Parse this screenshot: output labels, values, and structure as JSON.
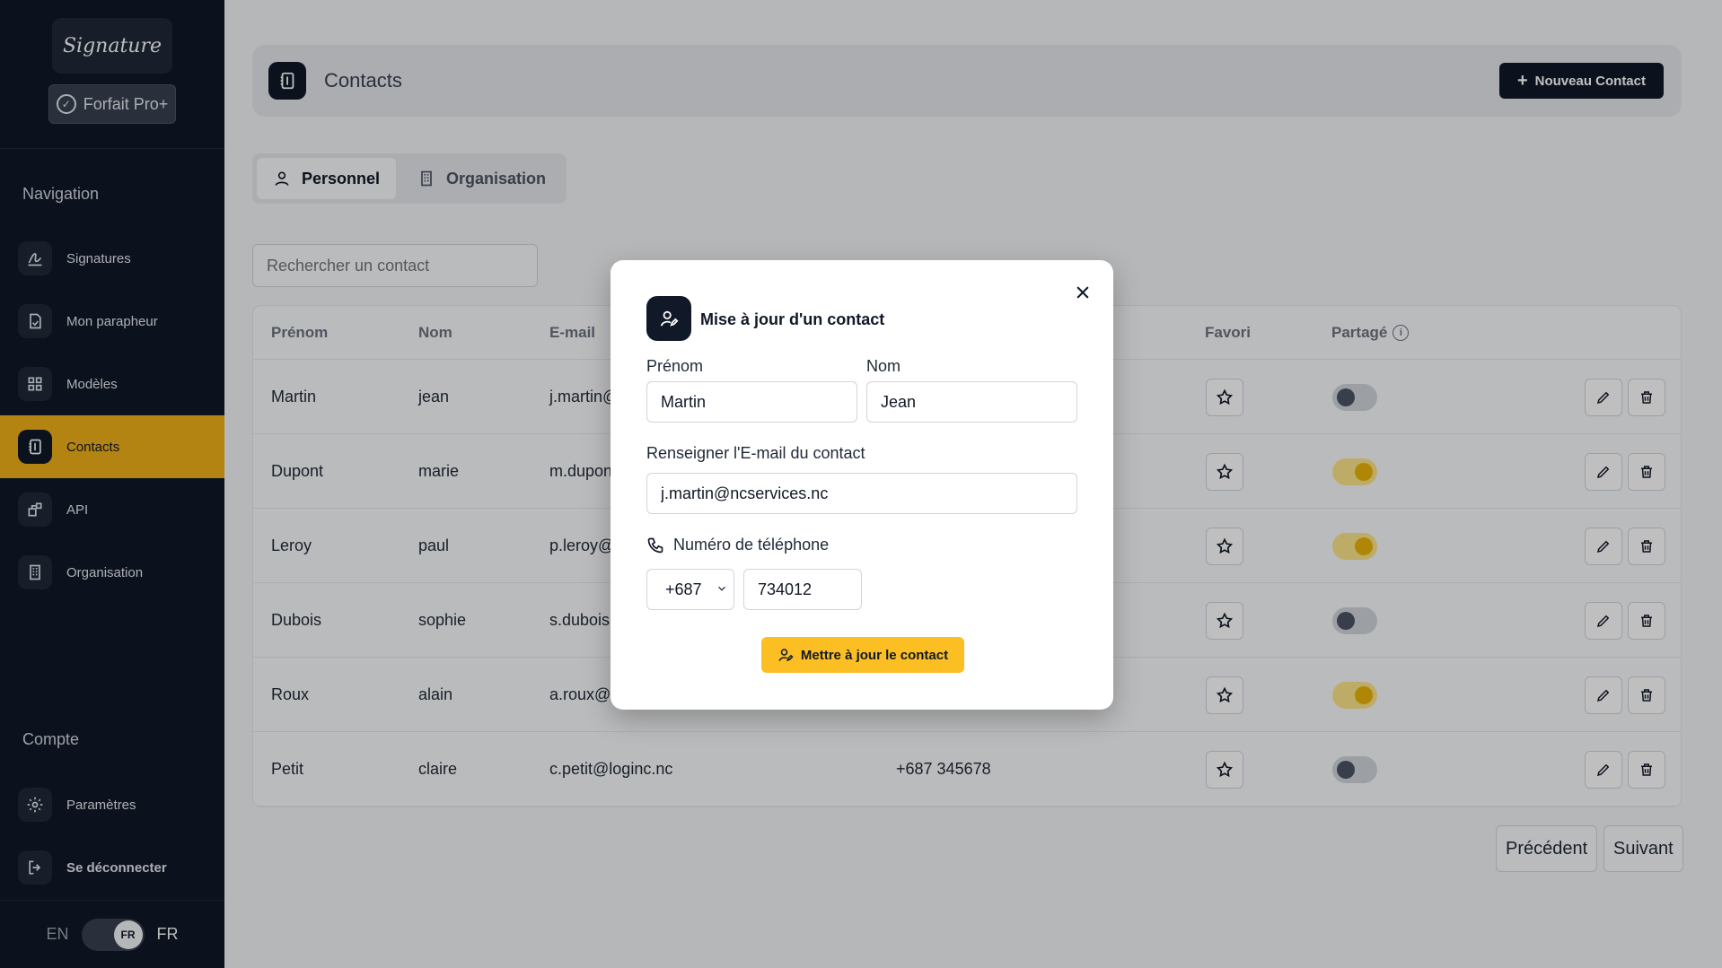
{
  "brand": {
    "logo_text": "Signature",
    "plan": "Forfait Pro+"
  },
  "sidebar": {
    "nav_label": "Navigation",
    "items": [
      {
        "label": "Signatures",
        "icon": "signature-icon"
      },
      {
        "label": "Mon parapheur",
        "icon": "document-icon"
      },
      {
        "label": "Modèles",
        "icon": "grid-icon"
      },
      {
        "label": "Contacts",
        "icon": "address-book-icon",
        "active": true
      },
      {
        "label": "API",
        "icon": "api-icon"
      },
      {
        "label": "Organisation",
        "icon": "building-icon"
      }
    ],
    "account_label": "Compte",
    "account_items": [
      {
        "label": "Paramètres",
        "icon": "gear-icon"
      },
      {
        "label": "Se déconnecter",
        "icon": "logout-icon"
      }
    ],
    "lang": {
      "left": "EN",
      "knob": "FR",
      "right": "FR"
    }
  },
  "header": {
    "title": "Contacts",
    "new_button": "Nouveau Contact"
  },
  "tabs": [
    {
      "label": "Personnel",
      "active": true
    },
    {
      "label": "Organisation"
    }
  ],
  "search": {
    "placeholder": "Rechercher un contact"
  },
  "table": {
    "columns": {
      "first": "Prénom",
      "last": "Nom",
      "email": "E-mail",
      "fav": "Favori",
      "shared": "Partagé"
    },
    "rows": [
      {
        "first": "Martin",
        "last": "jean",
        "email": "j.martin@",
        "phone": "",
        "shared": false
      },
      {
        "first": "Dupont",
        "last": "marie",
        "email": "m.dupon",
        "phone": "",
        "shared": true
      },
      {
        "first": "Leroy",
        "last": "paul",
        "email": "p.leroy@",
        "phone": "",
        "shared": true
      },
      {
        "first": "Dubois",
        "last": "sophie",
        "email": "s.dubois(",
        "phone": "",
        "shared": false
      },
      {
        "first": "Roux",
        "last": "alain",
        "email": "a.roux@a",
        "phone": "",
        "shared": true
      },
      {
        "first": "Petit",
        "last": "claire",
        "email": "c.petit@loginc.nc",
        "phone": "+687 345678",
        "shared": false
      }
    ]
  },
  "pagination": {
    "prev": "Précédent",
    "next": "Suivant"
  },
  "modal": {
    "title": "Mise à jour d'un contact",
    "first_label": "Prénom",
    "first_value": "Martin",
    "last_label": "Nom",
    "last_value": "Jean",
    "email_label": "Renseigner l'E-mail du contact",
    "email_value": "j.martin@ncservices.nc",
    "phone_label": "Numéro de téléphone",
    "phone_code": "+687",
    "phone_value": "734012",
    "submit": "Mettre à jour le contact"
  }
}
